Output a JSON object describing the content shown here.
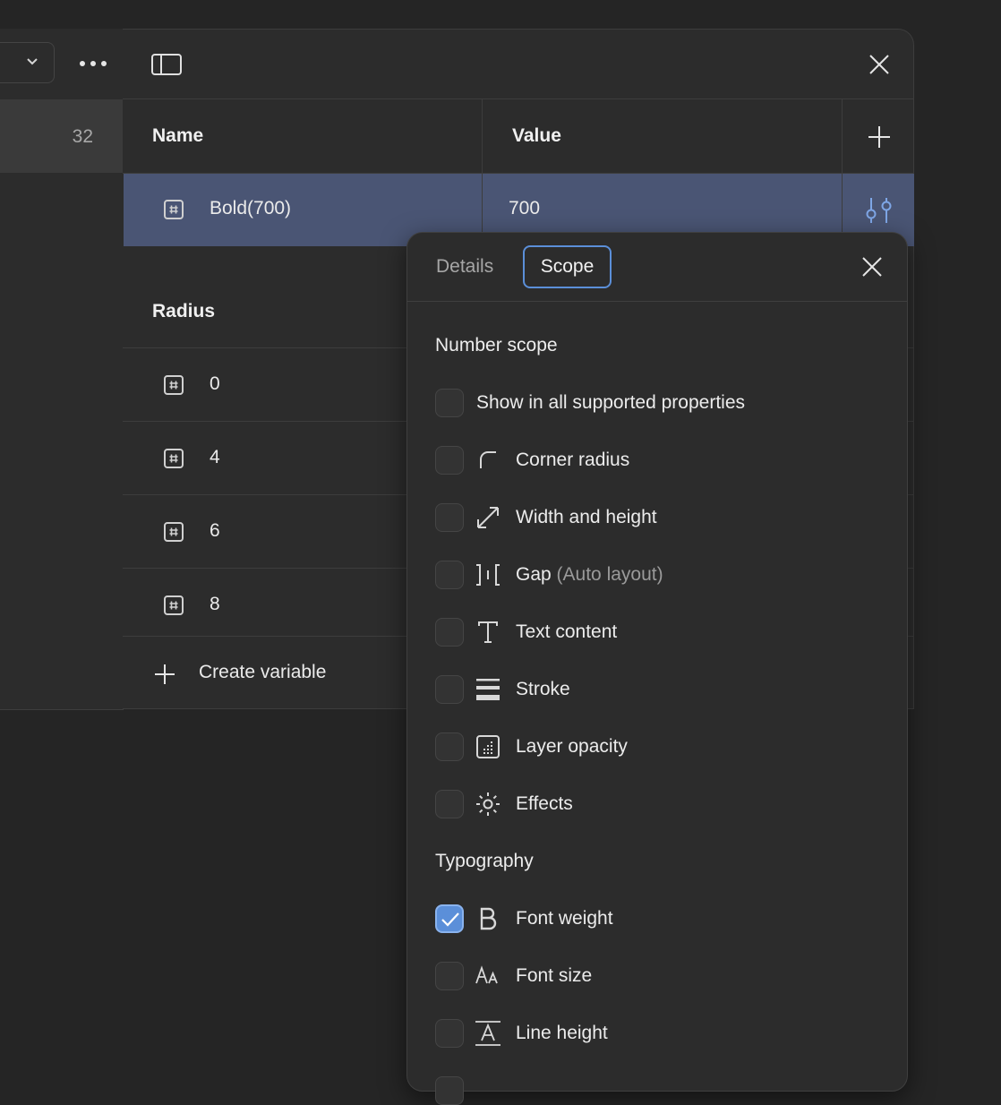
{
  "sidebar": {
    "count": "32"
  },
  "table": {
    "headers": {
      "name": "Name",
      "value": "Value"
    },
    "selected_row": {
      "name": "Bold(700)",
      "value": "700"
    },
    "group_title": "Radius",
    "rows": [
      {
        "name": "0"
      },
      {
        "name": "4"
      },
      {
        "name": "6"
      },
      {
        "name": "8"
      }
    ],
    "create_label": "Create variable"
  },
  "popover": {
    "tabs": {
      "details": "Details",
      "scope": "Scope"
    },
    "number_scope": {
      "title": "Number scope",
      "all": "Show in all supported properties",
      "options": [
        {
          "label": "Corner radius",
          "icon": "corner-radius-icon"
        },
        {
          "label": "Width and height",
          "icon": "resize-icon"
        },
        {
          "label": "Gap",
          "hint": "(Auto layout)",
          "icon": "gap-icon"
        },
        {
          "label": "Text content",
          "icon": "text-icon"
        },
        {
          "label": "Stroke",
          "icon": "stroke-icon"
        },
        {
          "label": "Layer opacity",
          "icon": "opacity-icon"
        },
        {
          "label": "Effects",
          "icon": "effects-icon"
        }
      ]
    },
    "typography": {
      "title": "Typography",
      "options": [
        {
          "label": "Font weight",
          "icon": "font-weight-icon",
          "checked": true
        },
        {
          "label": "Font size",
          "icon": "font-size-icon",
          "checked": false
        },
        {
          "label": "Line height",
          "icon": "line-height-icon",
          "checked": false
        }
      ]
    }
  },
  "colors": {
    "accent": "#5b8fd9",
    "selected_row": "#4a5574",
    "panel": "#2c2c2c",
    "background": "#252525"
  }
}
